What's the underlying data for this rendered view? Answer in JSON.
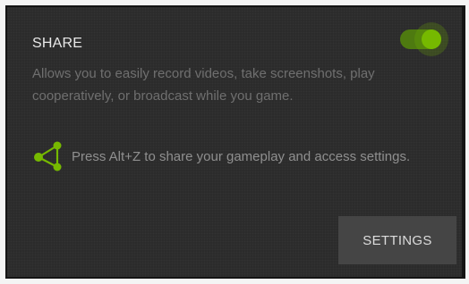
{
  "share_panel": {
    "title": "SHARE",
    "description": "Allows you to easily record videos, take screenshots, play cooperatively, or broadcast while you game.",
    "toggle": {
      "state": "on",
      "accent_color": "#76b900"
    },
    "hint": {
      "icon": "share-icon",
      "text": "Press Alt+Z to share your gameplay and access settings."
    },
    "settings_button_label": "SETTINGS"
  }
}
